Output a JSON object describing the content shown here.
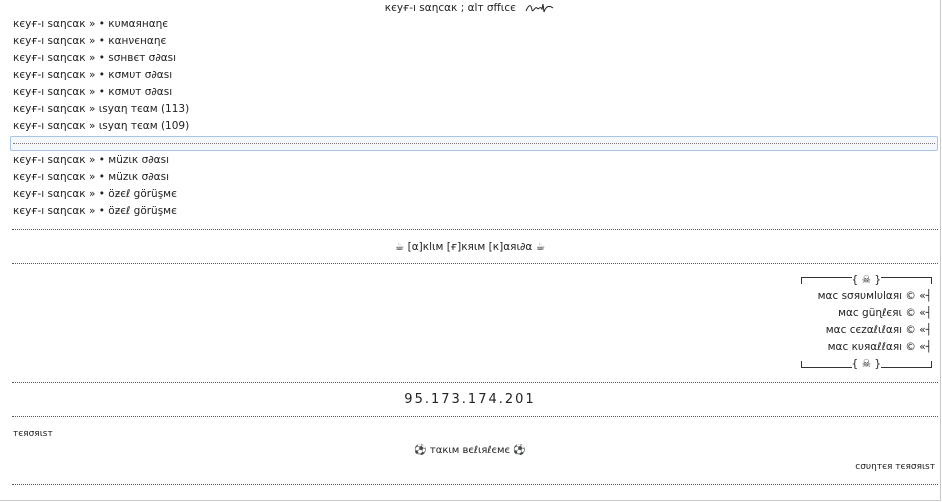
{
  "header": {
    "title": "кєуғ-ı ѕαηcαк ; αlт σffιcє"
  },
  "channels_top": [
    "кєуғ-ı ѕαηcαк » • кυмαянαηє",
    "кєуғ-ı ѕαηcαк » • кαнνєнαηє",
    "кєуғ-ı ѕαηcαк » • ѕσнвєт σ∂αѕı",
    "кєуғ-ı ѕαηcαк » • кσмυт σ∂αѕı",
    "кєуғ-ı ѕαηcαк » • кσмυт σ∂αѕı",
    "кєуғ-ı ѕαηcαк » ιѕуαη тєαм (113)",
    "кєуғ-ı ѕαηcαк » ιѕуαη тєαм (109)"
  ],
  "channels_bottom": [
    "кєуғ-ı ѕαηcαк » • мüzιк σ∂αѕı",
    "кєуғ-ı ѕαηcαк » • мüzιк σ∂αѕı",
    "кєуғ-ı ѕαηcαк » • öƶєℓ görüşмє",
    "кєуғ-ı ѕαηcαк » • öƶєℓ görüşмє"
  ],
  "banner": {
    "icon_left": "☕",
    "text": "[α]кlιм [ғ]кяιм [к]αяι∂α",
    "icon_right": "☕"
  },
  "rules": {
    "top_symbol": "{ ☠ }",
    "bottom_symbol": "{ ☠ }",
    "items": [
      "мαc ѕσяυмlυlαяı © «",
      "мαc güɳℓєяι © «",
      "мαc cєzαℓιℓαяı © «",
      "мαc кυяαℓℓαяı © «"
    ]
  },
  "server": {
    "ip": "95.173.174.201"
  },
  "teams": {
    "left": "тєяσяιѕт",
    "center_icon_left": "⚽",
    "center_text": "тαкιм вєℓιяℓємє",
    "center_icon_right": "⚽",
    "right": "cσυηтєя тєяσяιѕт"
  }
}
